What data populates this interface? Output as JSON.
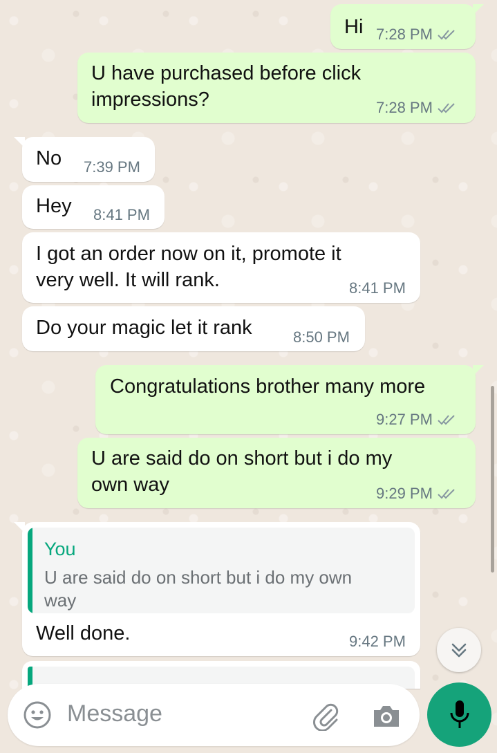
{
  "messages": [
    {
      "id": "m1",
      "dir": "out",
      "text": "Hi",
      "time": "7:28 PM"
    },
    {
      "id": "m2",
      "dir": "out",
      "line1": "U have purchased before click",
      "line2": "impressions?",
      "time": "7:28 PM"
    },
    {
      "id": "m3",
      "dir": "in",
      "text": "No",
      "time": "7:39 PM"
    },
    {
      "id": "m4",
      "dir": "in",
      "text": "Hey",
      "time": "8:41 PM"
    },
    {
      "id": "m5",
      "dir": "in",
      "line1": "I got an order now on it, promote it",
      "line2": "very well. It will rank.",
      "time": "8:41 PM"
    },
    {
      "id": "m6",
      "dir": "in",
      "text": "Do your magic let it rank",
      "time": "8:50 PM"
    },
    {
      "id": "m7",
      "dir": "out",
      "text": "Congratulations brother many more",
      "time": "9:27 PM"
    },
    {
      "id": "m8",
      "dir": "out",
      "line1": "U are said do on short but i do my",
      "line2": "own way",
      "time": "9:29 PM"
    },
    {
      "id": "m9",
      "dir": "in",
      "quote_author": "You",
      "quote_text": "U are said do on short but i do my own way",
      "text": "Well done.",
      "time": "9:42 PM"
    }
  ],
  "composer": {
    "placeholder": "Message"
  },
  "icons": {
    "emoji": "emoji-icon",
    "attach": "paperclip-icon",
    "camera": "camera-icon",
    "mic": "microphone-icon",
    "read": "double-check-icon",
    "scroll": "chevron-double-down-icon"
  },
  "colors": {
    "outgoing": "#e1fecf",
    "incoming": "#ffffff",
    "accent": "#15a37a",
    "ticks": "#8696a0",
    "wallpaper": "#efe7de"
  }
}
